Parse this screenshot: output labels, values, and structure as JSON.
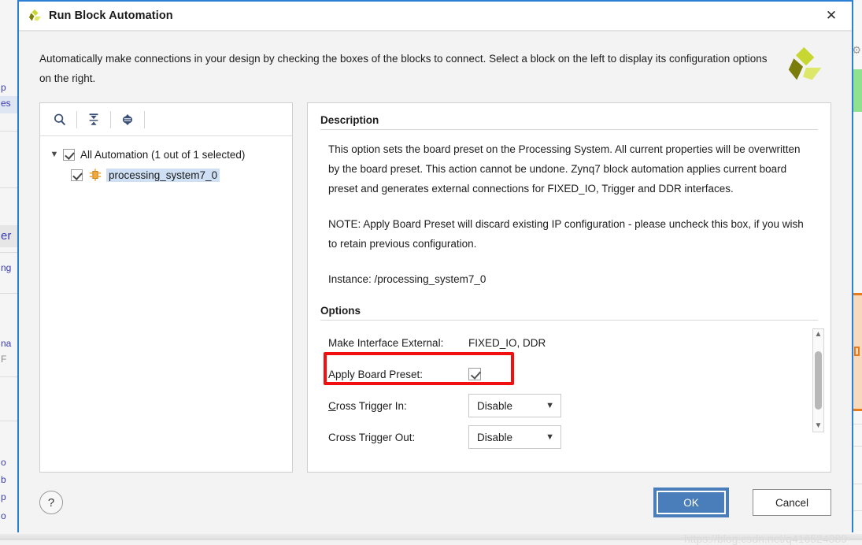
{
  "dialog": {
    "title": "Run Block Automation",
    "logo_icon": "xilinx-logo-icon",
    "close_icon": "close-icon",
    "intro_text": "Automatically make connections in your design by checking the boxes of the blocks to connect. Select a block on the left to display its configuration options on the right.",
    "accent_color": "#2b7fd4"
  },
  "tree_toolbar": {
    "search_icon": "search-icon",
    "collapse_all_icon": "collapse-all-icon",
    "expand_all_icon": "expand-all-icon"
  },
  "tree": {
    "root": {
      "label": "All Automation (1 out of 1 selected)",
      "checked": true,
      "expanded": true,
      "twisty_icon": "chevron-down-icon"
    },
    "children": [
      {
        "label": "processing_system7_0",
        "checked": true,
        "selected": true,
        "icon": "ip-block-icon"
      }
    ]
  },
  "detail": {
    "description_heading": "Description",
    "paragraphs": [
      "This option sets the board preset on the Processing System. All current properties will be overwritten by the board preset. This action cannot be undone. Zynq7 block automation applies current board preset and generates external connections for FIXED_IO, Trigger and DDR interfaces.",
      "NOTE: Apply Board Preset will discard existing IP configuration - please uncheck this box, if you wish to retain previous configuration.",
      "Instance: /processing_system7_0"
    ],
    "options_heading": "Options",
    "options": [
      {
        "label": "Make Interface External:",
        "type": "text",
        "value": "FIXED_IO, DDR"
      },
      {
        "label": "Apply Board Preset:",
        "type": "checkbox",
        "checked": true,
        "highlighted": true,
        "highlight_color": "#f01010"
      },
      {
        "label": "Cross Trigger In:",
        "label_mnemonic": "C",
        "type": "dropdown",
        "value": "Disable",
        "chevron_icon": "chevron-down-icon"
      },
      {
        "label": "Cross Trigger Out:",
        "type": "dropdown",
        "value": "Disable",
        "chevron_icon": "chevron-down-icon"
      }
    ],
    "scrollbar": {
      "up_icon": "chevron-up-icon",
      "down_icon": "chevron-down-icon"
    }
  },
  "footer": {
    "help_label": "?",
    "ok_label": "OK",
    "cancel_label": "Cancel"
  },
  "watermark": {
    "text": "https://blog.csdn.net/q416524389"
  },
  "background": {
    "left_fragments": [
      "p",
      "es",
      "er",
      "ng",
      "na",
      "F",
      "o",
      "b",
      "p",
      "o"
    ],
    "bottom_text": ""
  }
}
